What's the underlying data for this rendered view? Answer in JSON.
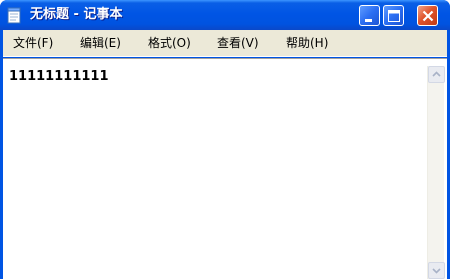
{
  "window": {
    "title": "无标题 - 记事本",
    "controls": {
      "minimize": "minimize-icon",
      "maximize": "maximize-icon",
      "close": "close-icon"
    }
  },
  "menu": {
    "items": [
      {
        "label": "文件(F)"
      },
      {
        "label": "编辑(E)"
      },
      {
        "label": "格式(O)"
      },
      {
        "label": "查看(V)"
      },
      {
        "label": "帮助(H)"
      }
    ]
  },
  "editor": {
    "content": "11111111111"
  },
  "colors": {
    "titlebar": "#0055e5",
    "close_button": "#e0542c",
    "menubar": "#ece9d8"
  }
}
